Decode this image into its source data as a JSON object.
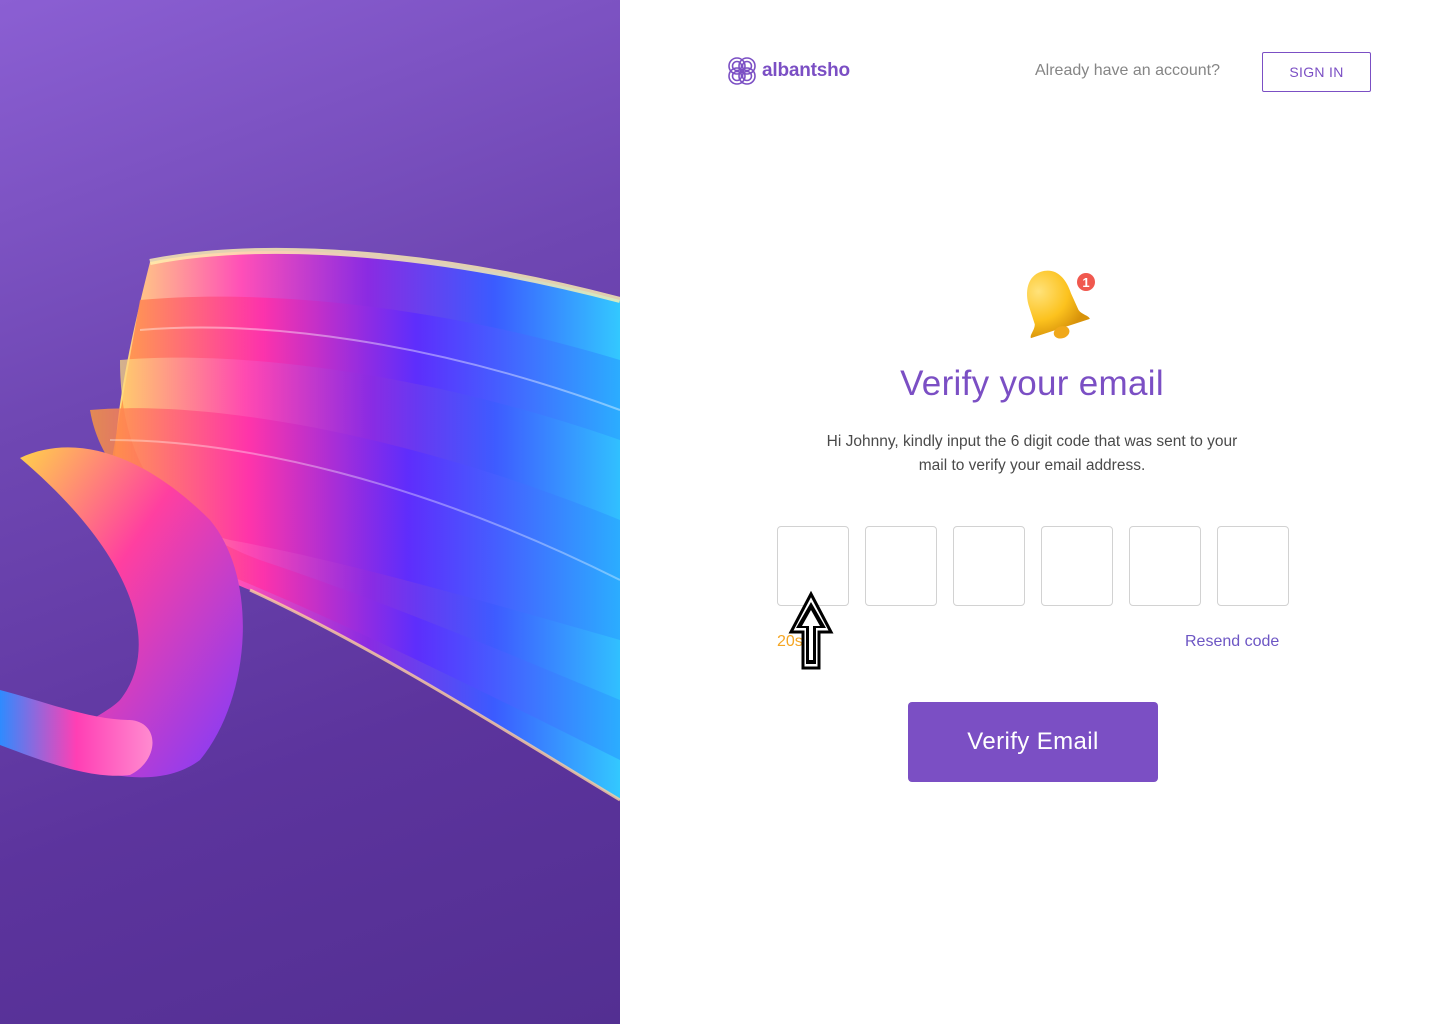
{
  "brand": {
    "name": "albantsho"
  },
  "header": {
    "account_question": "Already have an account?",
    "signin_label": "SIGN IN"
  },
  "main": {
    "title": "Verify your email",
    "description": "Hi Johnny, kindly input the 6 digit code that was sent to your mail to verify your email address.",
    "notification_count": "1",
    "otp_boxes": [
      "",
      "",
      "",
      "",
      "",
      ""
    ],
    "timer": "20s",
    "resend_label": "Resend code",
    "verify_label": "Verify Email"
  },
  "colors": {
    "brand": "#7b4fc4",
    "timer": "#f5a623",
    "resend": "#6d56c4",
    "badge": "#f0584e"
  },
  "icons": [
    "bell-notification-icon",
    "albantsho-logo-icon",
    "cursor-arrow-icon"
  ]
}
